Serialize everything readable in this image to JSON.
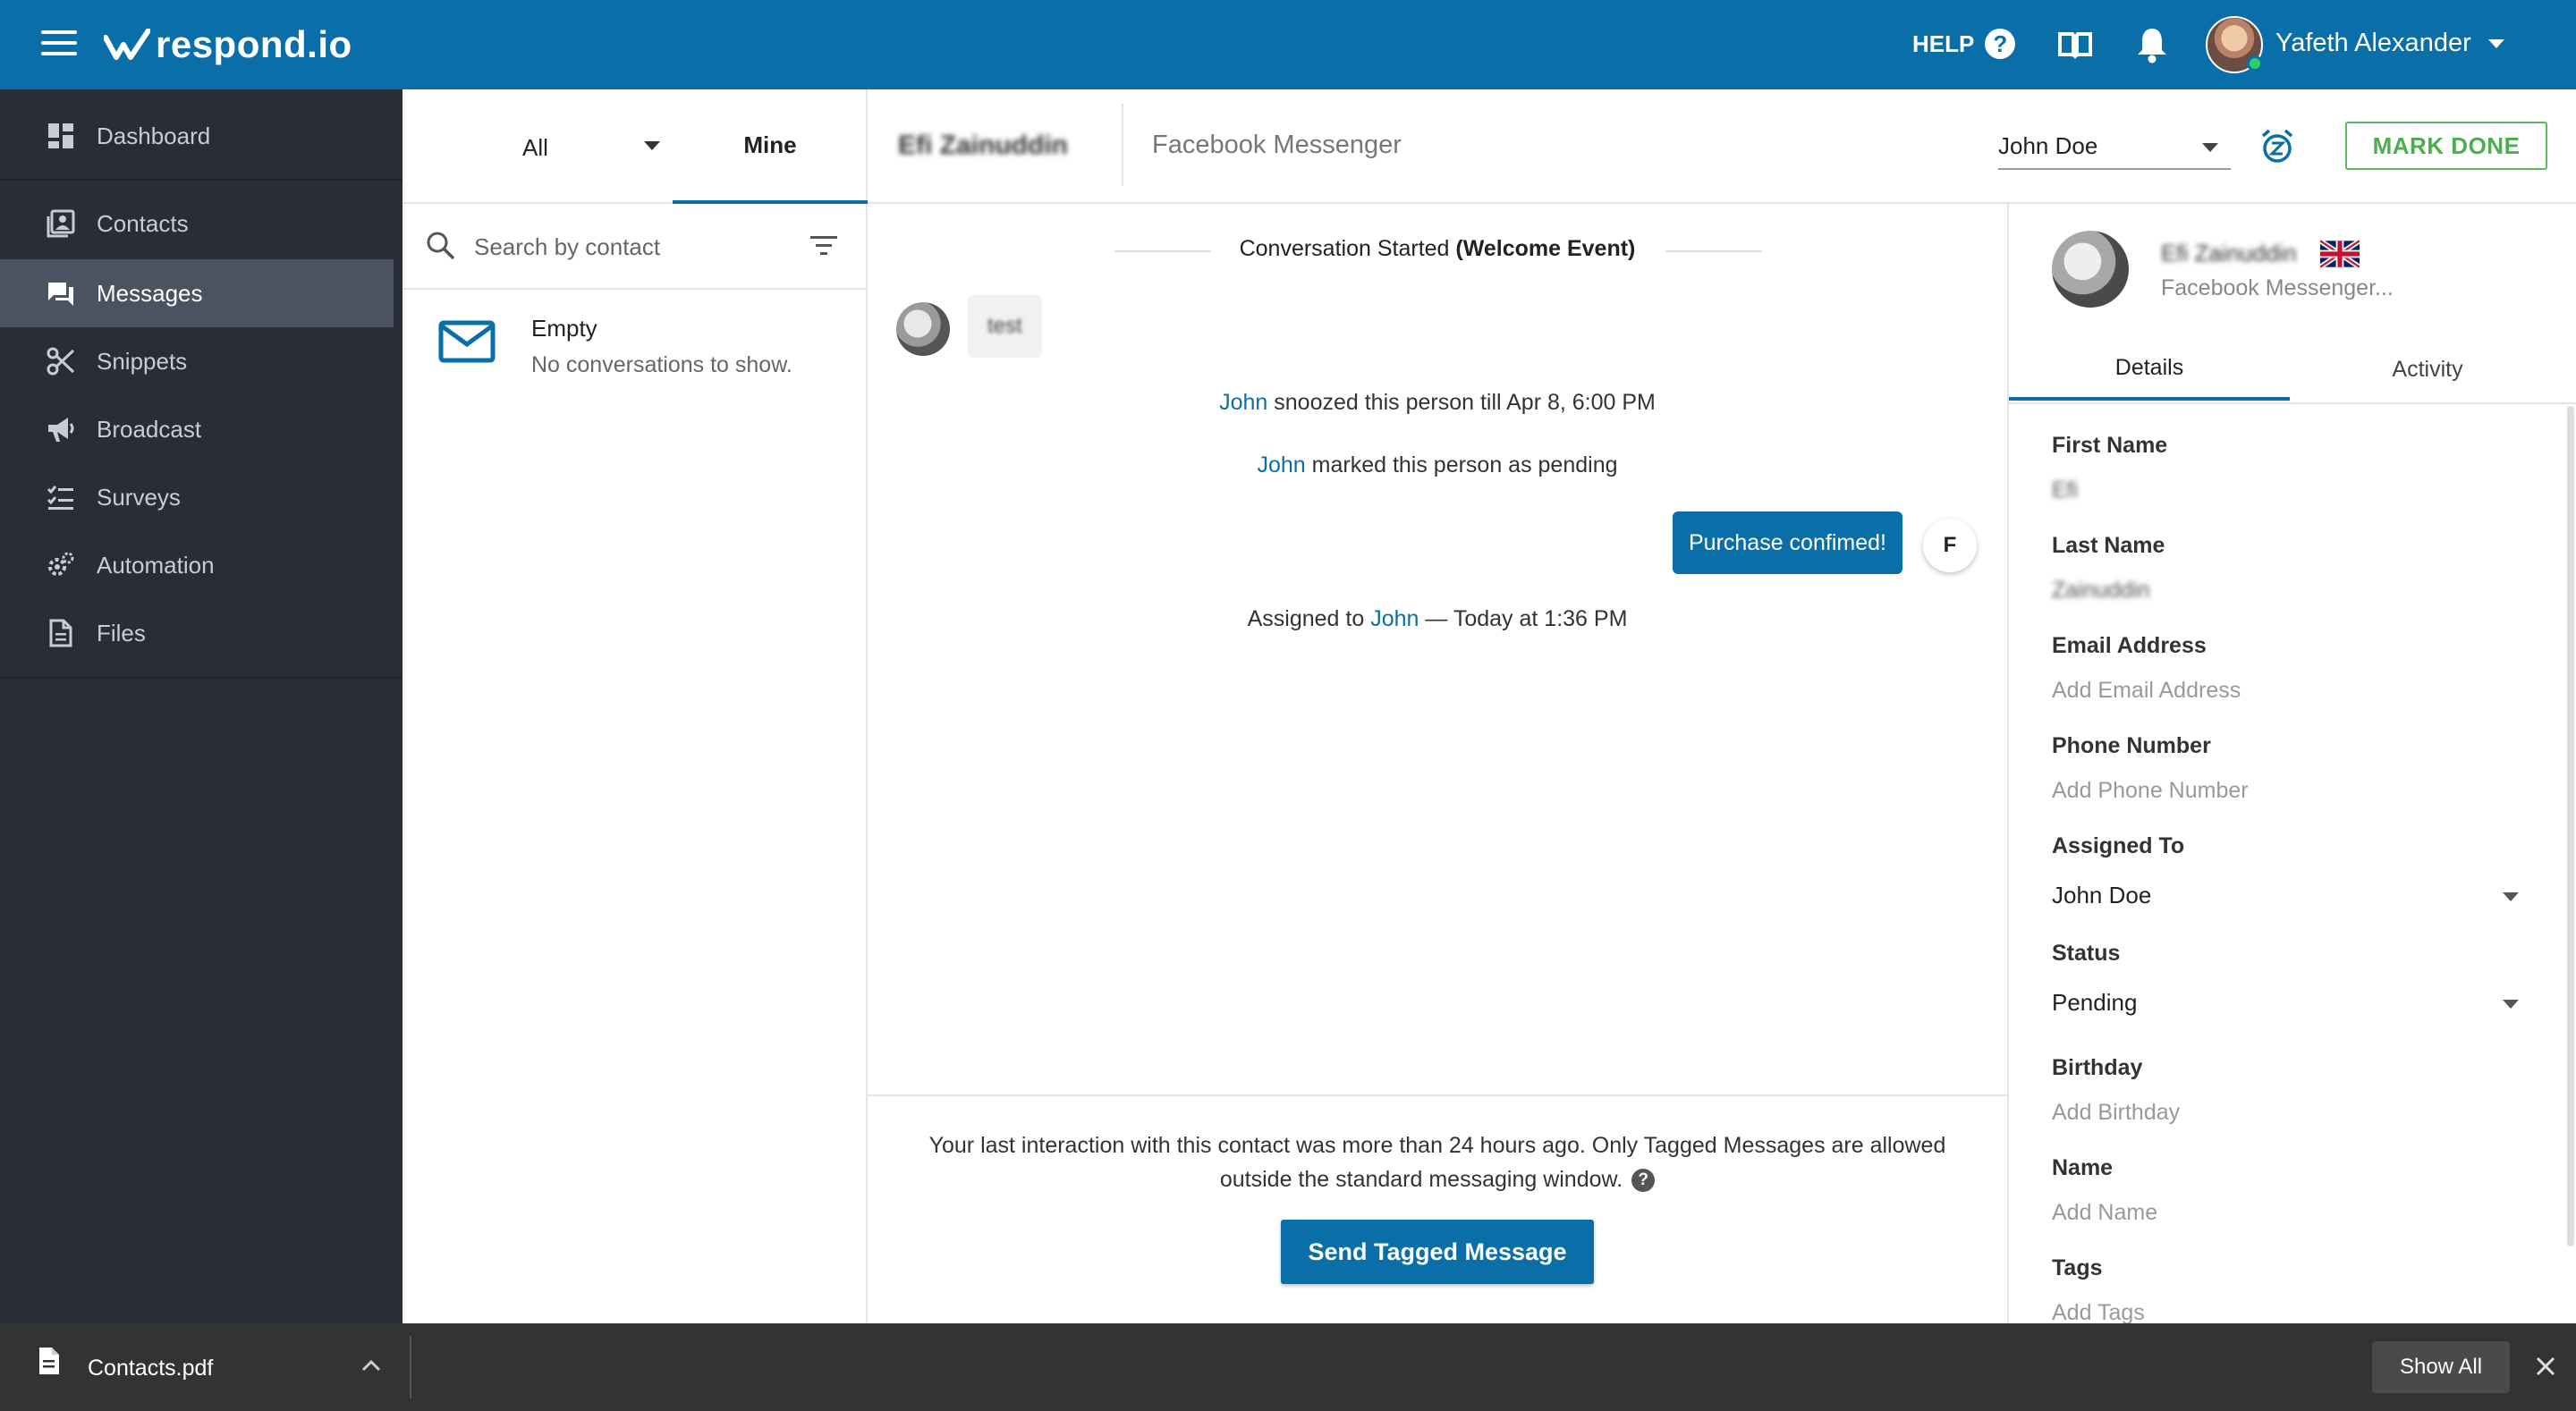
{
  "topbar": {
    "logo_text": "respond.io",
    "help_label": "HELP",
    "help_icon": "?",
    "user_name": "Yafeth Alexander",
    "brand_color": "#0a6fa8",
    "online_color": "#2bd067"
  },
  "sidebar": {
    "items": [
      {
        "label": "Dashboard",
        "icon": "dashboard-icon"
      },
      {
        "label": "Contacts",
        "icon": "contacts-icon"
      },
      {
        "label": "Messages",
        "icon": "messages-icon",
        "active": true
      },
      {
        "label": "Snippets",
        "icon": "scissors-icon"
      },
      {
        "label": "Broadcast",
        "icon": "megaphone-icon"
      },
      {
        "label": "Surveys",
        "icon": "checklist-icon"
      },
      {
        "label": "Automation",
        "icon": "gears-icon"
      },
      {
        "label": "Files",
        "icon": "file-icon"
      }
    ]
  },
  "conversation_list": {
    "tab_all": "All",
    "tab_mine": "Mine",
    "search_placeholder": "Search by contact",
    "empty_title": "Empty",
    "empty_subtitle": "No conversations to show."
  },
  "chat_header": {
    "contact_name": "Efi Zainuddin",
    "channel": "Facebook Messenger",
    "assignee": "John Doe",
    "mark_done_label": "MARK DONE",
    "mark_done_color": "#5cb85c"
  },
  "chat": {
    "conversation_started": "Conversation Started",
    "conversation_started_event": "(Welcome Event)",
    "incoming_message": "test",
    "events": [
      {
        "agent": "John",
        "text": " snoozed this person till Apr 8, 6:00 PM"
      },
      {
        "agent": "John",
        "text": " marked this person as pending"
      }
    ],
    "outgoing_message": "Purchase confimed!",
    "outgoing_avatar_initial": "F",
    "assigned_prefix": "Assigned to ",
    "assigned_agent": "John",
    "assigned_suffix": " — Today at 1:36 PM"
  },
  "chat_footer": {
    "note": "Your last interaction with this contact was more than 24 hours ago. Only Tagged Messages are allowed outside the standard messaging window.",
    "help_icon": "?",
    "send_tagged_label": "Send Tagged Message"
  },
  "details": {
    "name": "Efi Zainuddin",
    "channel": "Facebook Messenger...",
    "flag": "uk-flag-icon",
    "tab_details": "Details",
    "tab_activity": "Activity",
    "fields": {
      "first_name_label": "First Name",
      "first_name_value": "Efi",
      "last_name_label": "Last Name",
      "last_name_value": "Zainuddin",
      "email_label": "Email Address",
      "email_placeholder": "Add Email Address",
      "phone_label": "Phone Number",
      "phone_placeholder": "Add Phone Number",
      "assigned_label": "Assigned To",
      "assigned_value": "John Doe",
      "status_label": "Status",
      "status_value": "Pending",
      "birthday_label": "Birthday",
      "birthday_placeholder": "Add Birthday",
      "name_label": "Name",
      "name_placeholder": "Add Name",
      "tags_label": "Tags",
      "tags_placeholder": "Add Tags"
    }
  },
  "download_bar": {
    "file_name": "Contacts.pdf",
    "show_all_label": "Show All"
  }
}
